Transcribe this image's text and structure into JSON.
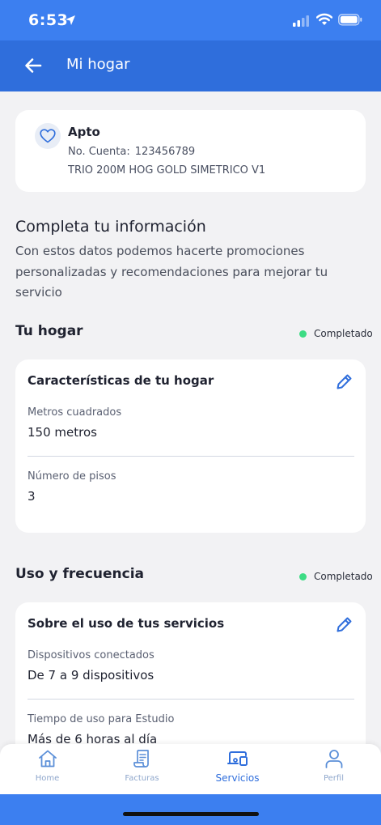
{
  "status_bar": {
    "time": "6:53"
  },
  "header": {
    "title": "Mi hogar"
  },
  "account": {
    "type": "Apto",
    "account_label": "No. Cuenta:",
    "account_number": "123456789",
    "plan": "TRIO 200M HOG GOLD SIMETRICO V1"
  },
  "intro": {
    "title": "Completa tu información",
    "description": "Con estos datos podemos hacerte promociones personalizadas y recomendaciones para mejorar tu servicio"
  },
  "home_section": {
    "title": "Tu hogar",
    "status": "Completado",
    "status_color": "#3ddc84",
    "card_title": "Características de tu hogar",
    "fields": [
      {
        "label": "Metros cuadrados",
        "value": "150 metros"
      },
      {
        "label": "Número de pisos",
        "value": "3"
      }
    ]
  },
  "usage_section": {
    "title": "Uso y frecuencia",
    "status": "Completado",
    "status_color": "#3ddc84",
    "card_title": "Sobre el uso de tus servicios",
    "fields": [
      {
        "label": "Dispositivos conectados",
        "value": "De 7 a 9 dispositivos"
      },
      {
        "label": "Tiempo de uso para Estudio",
        "value": "Más de 6 horas al día"
      }
    ]
  },
  "bottom_nav": {
    "items": [
      {
        "label": "Home",
        "icon": "home-icon"
      },
      {
        "label": "Facturas",
        "icon": "receipt-icon"
      },
      {
        "label": "Servicios",
        "icon": "devices-icon",
        "active": true
      },
      {
        "label": "Perfil",
        "icon": "user-icon"
      }
    ]
  },
  "colors": {
    "accent": "#2f6edc",
    "status_bar": "#3c7ff0",
    "inactive_nav": "#8fa7cc"
  }
}
